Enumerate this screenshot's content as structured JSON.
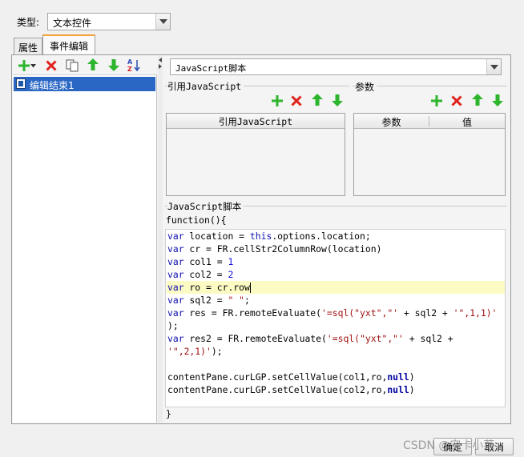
{
  "type_row": {
    "label": "类型:",
    "value": "文本控件"
  },
  "tabs": [
    {
      "label": "属性"
    },
    {
      "label": "事件编辑"
    }
  ],
  "tree": {
    "selected_item": "编辑结束1"
  },
  "script_select": {
    "value": "JavaScript脚本"
  },
  "sections": {
    "ref_js": "引用JavaScript",
    "params": "参数",
    "script": "JavaScript脚本"
  },
  "ref_table": {
    "header": "引用JavaScript"
  },
  "param_table": {
    "headers": [
      "参数",
      "值"
    ]
  },
  "code": {
    "header": "function(){",
    "footer": "}",
    "lines": [
      "var location = this.options.location;",
      "var cr = FR.cellStr2ColumnRow(location)",
      "var col1 = 1",
      "var col2 = 2",
      "var ro = cr.row",
      "var sql2 = \" \";",
      "var res = FR.remoteEvaluate('=sql(\"yxt\",\"' + sql2 + '\",1,1)'",
      ");",
      "var res2 = FR.remoteEvaluate('=sql(\"yxt\",\"' + sql2 +",
      "'\",2,1)');",
      "",
      "contentPane.curLGP.setCellValue(col1,ro,null)",
      "contentPane.curLGP.setCellValue(col2,ro,null)"
    ]
  },
  "buttons": {
    "ok": "确定",
    "cancel": "取消"
  },
  "watermark": "CSDN @安卡小菜",
  "colors": {
    "add": "#2db52d",
    "delete": "#e0231f",
    "move": "#2db52d",
    "selection": "#2a67c5",
    "highlight_line": "#fdfbc4"
  },
  "icons": {
    "left_toolbar": [
      "add-icon",
      "dropdown-arrow-icon",
      "delete-icon",
      "copy-icon",
      "move-up-icon",
      "move-down-icon",
      "sort-az-icon"
    ],
    "ref_toolbar": [
      "add-icon",
      "delete-icon",
      "move-up-icon",
      "move-down-icon"
    ],
    "param_toolbar": [
      "add-icon",
      "delete-icon",
      "move-up-icon",
      "move-down-icon"
    ]
  }
}
